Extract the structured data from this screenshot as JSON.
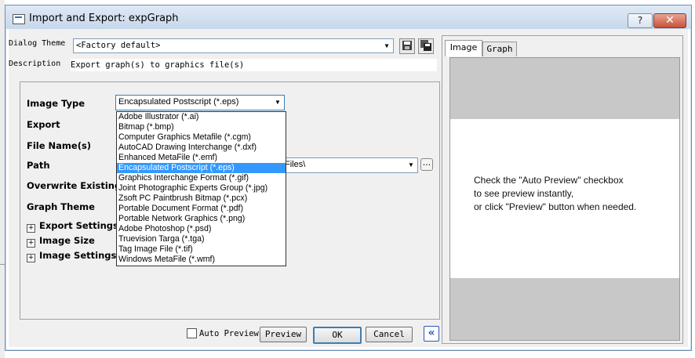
{
  "window": {
    "title": "Import and Export: expGraph",
    "help": "?",
    "close": "✕"
  },
  "theme": {
    "label": "Dialog Theme",
    "value": "<Factory default>"
  },
  "description": {
    "label": "Description",
    "value": "Export graph(s) to graphics file(s)"
  },
  "fields": {
    "image_type": "Image Type",
    "export": "Export",
    "file_names": "File Name(s)",
    "path": "Path",
    "overwrite": "Overwrite Existing",
    "graph_theme": "Graph Theme"
  },
  "image_type_value": "Encapsulated Postscript (*.eps)",
  "path_value": "Files\\",
  "browse_label": "...",
  "groups": [
    {
      "label": "Export Settings",
      "toggle": "+"
    },
    {
      "label": "Image Size",
      "toggle": "+"
    },
    {
      "label": "Image Settings",
      "toggle": "+"
    }
  ],
  "dropdown_items": [
    "Adobe Illustrator (*.ai)",
    "Bitmap (*.bmp)",
    "Computer Graphics Metafile (*.cgm)",
    "AutoCAD Drawing Interchange (*.dxf)",
    "Enhanced MetaFile (*.emf)",
    "Encapsulated Postscript (*.eps)",
    "Graphics Interchange Format (*.gif)",
    "Joint Photographic Experts Group (*.jpg)",
    "Zsoft PC Paintbrush Bitmap (*.pcx)",
    "Portable Document Format (*.pdf)",
    "Portable Network Graphics (*.png)",
    "Adobe Photoshop (*.psd)",
    "Truevision Targa (*.tga)",
    "Tag Image File (*.tif)",
    "Windows MetaFile (*.wmf)"
  ],
  "selected_index": 5,
  "bottom": {
    "auto_preview": "Auto Preview",
    "preview": "Preview",
    "ok": "OK",
    "cancel": "Cancel",
    "collapse": "«"
  },
  "tabs": [
    "Image",
    "Graph"
  ],
  "preview_hint": [
    "Check the \"Auto Preview\" checkbox",
    "to see preview instantly,",
    "or click \"Preview\" button when needed."
  ]
}
